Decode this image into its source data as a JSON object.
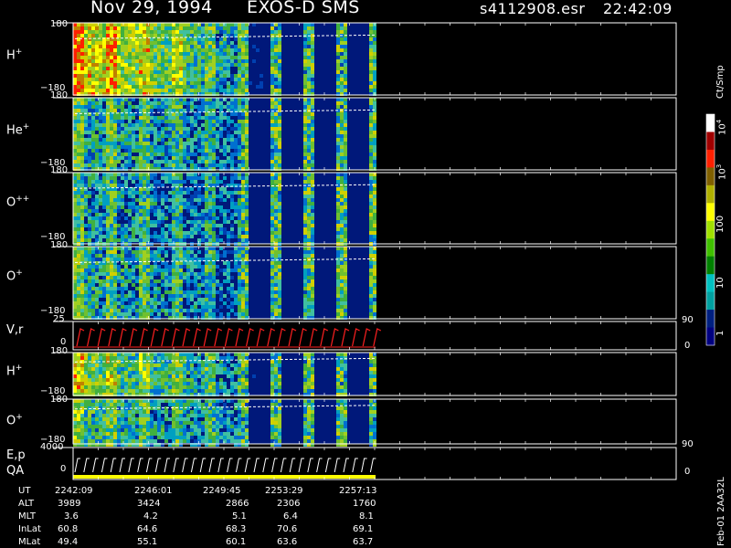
{
  "header": {
    "date": "Nov 29, 1994",
    "instrument": "EXOS-D SMS",
    "file": "s4112908.esr",
    "time": "22:42:09"
  },
  "panels": [
    {
      "label": "H+",
      "sym": "H",
      "sup": "+",
      "top_tick": "180",
      "bottom_tick": "−180"
    },
    {
      "label": "He+",
      "sym": "He",
      "sup": "+",
      "top_tick": "180",
      "bottom_tick": "−180"
    },
    {
      "label": "O++",
      "sym": "O",
      "sup": "++",
      "top_tick": "180",
      "bottom_tick": "−180"
    },
    {
      "label": "O+",
      "sym": "O",
      "sup": "+",
      "top_tick": "180",
      "bottom_tick": "−180"
    },
    {
      "label": "V,r",
      "sym": "V,r",
      "sup": "",
      "top_tick": "25",
      "bottom_tick": "0",
      "right_top": "90",
      "right_bottom": "0"
    },
    {
      "label": "H+",
      "sym": "H",
      "sup": "+",
      "top_tick": "180",
      "bottom_tick": "−180"
    },
    {
      "label": "O+",
      "sym": "O",
      "sup": "+",
      "top_tick": "180",
      "bottom_tick": "−180"
    },
    {
      "label": "E,p QA",
      "sym": "E,p",
      "sym2": "QA",
      "sup": "",
      "top_tick": "4000",
      "bottom_tick": "0",
      "right_top": "90",
      "right_bottom": "0"
    }
  ],
  "colorbar": {
    "unit": "Ct/Smp",
    "labels": [
      "10^4",
      "10^3",
      "100",
      "10",
      "1"
    ],
    "colors": [
      "#ffffff",
      "#a00000",
      "#ff2000",
      "#806000",
      "#b0b000",
      "#ffff00",
      "#a0e000",
      "#40c000",
      "#008000",
      "#00c0c0",
      "#00a0a0",
      "#002080",
      "#000080"
    ]
  },
  "ephemeris": {
    "rows": [
      "UT",
      "ALT",
      "MLT",
      "InLat",
      "MLat"
    ],
    "columns": [
      [
        "2242:09",
        "3989",
        "3.6",
        "60.8",
        "49.4"
      ],
      [
        "2246:01",
        "3424",
        "4.2",
        "64.6",
        "55.1"
      ],
      [
        "2249:45",
        "2866",
        "5.1",
        "68.3",
        "60.1"
      ],
      [
        "2253:29",
        "2306",
        "6.4",
        "70.6",
        "63.6"
      ],
      [
        "2257:13",
        "1760",
        "8.1",
        "69.1",
        "63.7"
      ]
    ]
  },
  "footer_note": "Feb-01 2AA32L",
  "chart_data": {
    "type": "heatmap",
    "title": "Nov 29, 1994   EXOS-D SMS",
    "x_ticks": [
      "2242:09",
      "2246:01",
      "2249:45",
      "2253:29",
      "2257:13"
    ],
    "y_axis_range": [
      -180,
      180
    ],
    "color_scale": "log",
    "color_range": [
      1,
      10000
    ],
    "color_unit": "Ct/Smp",
    "series": [
      {
        "name": "H+"
      },
      {
        "name": "He+"
      },
      {
        "name": "O++"
      },
      {
        "name": "O+"
      },
      {
        "name": "V,r",
        "ylim": [
          0,
          25
        ],
        "y2lim": [
          0,
          90
        ]
      },
      {
        "name": "H+"
      },
      {
        "name": "O+"
      },
      {
        "name": "E,p QA",
        "ylim": [
          0,
          4000
        ],
        "y2lim": [
          0,
          90
        ]
      }
    ]
  }
}
